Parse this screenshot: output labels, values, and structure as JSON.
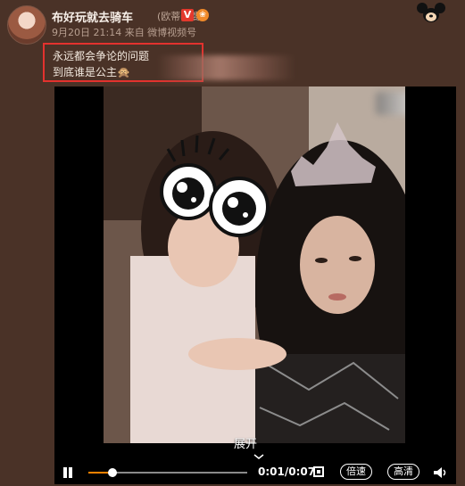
{
  "post": {
    "username": "布好玩就去骑车",
    "remark": "(欧蒂老婆)",
    "verified_badge": "V",
    "meta": "9月20日 21:14 来自 微博视频号",
    "lines": [
      "永远都会争论的问题",
      "到底谁是公主🙊"
    ]
  },
  "video": {
    "expand_label": "展开",
    "time_current": "0:01",
    "time_total": "0:07",
    "progress_fraction": 0.15,
    "speed_label": "倍速",
    "quality_label": "高清"
  },
  "icons": {
    "avatar": "avatar",
    "mickey": "mickey-mouse-icon",
    "pause": "pause-icon",
    "fullscreen": "fullscreen-icon",
    "volume": "volume-icon",
    "arrow": "red-arrow-annotation"
  },
  "colors": {
    "background": "#4a3227",
    "highlight_box": "#e3322e",
    "progress": "#ff8200"
  }
}
